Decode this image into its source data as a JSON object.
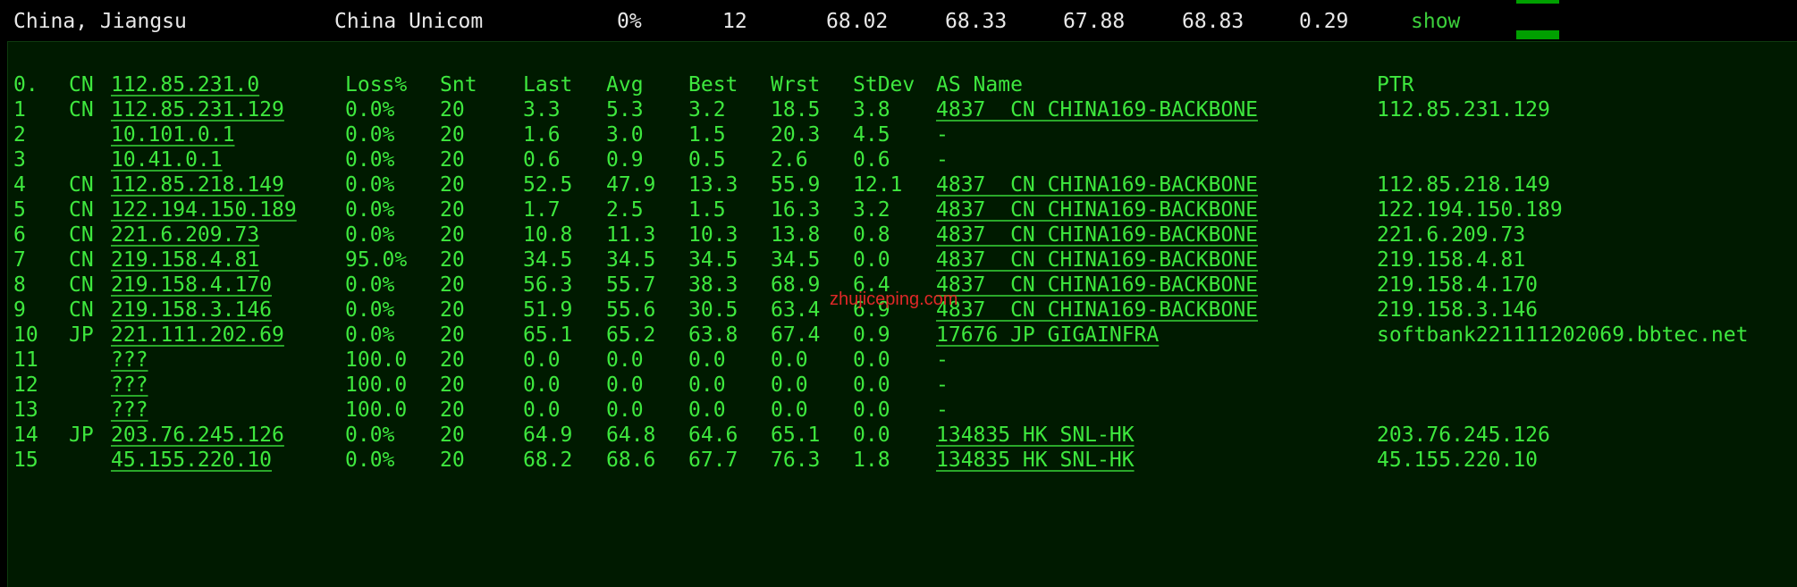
{
  "summary": {
    "location": "China, Jiangsu",
    "isp": "China Unicom",
    "loss": "0%",
    "sent": "12",
    "last": "68.02",
    "avg": "68.33",
    "best": "67.88",
    "worst": "68.83",
    "stdev": "0.29",
    "show_label": "show"
  },
  "colors": {
    "terminal_bg": "#001a00",
    "terminal_fg": "#3ee83e",
    "summary_fg": "#e8e8e8",
    "status_green": "#00a000",
    "watermark": "#e02828"
  },
  "watermark": "zhujiceping.com",
  "trace": {
    "headers": {
      "hop": "0.",
      "cc": "CN",
      "host": "112.85.231.0",
      "loss": "Loss%",
      "snt": "Snt",
      "last": "Last",
      "avg": "Avg",
      "best": "Best",
      "wrst": "Wrst",
      "stdev": "StDev",
      "as": "AS Name",
      "ptr": "PTR"
    },
    "rows": [
      {
        "hop": "1",
        "cc": "CN",
        "host": "112.85.231.129",
        "loss": "0.0%",
        "snt": "20",
        "last": "3.3",
        "avg": "5.3",
        "best": "3.2",
        "wrst": "18.5",
        "stdev": "3.8",
        "as": "4837  CN CHINA169-BACKBONE",
        "ptr": "112.85.231.129"
      },
      {
        "hop": "2",
        "cc": "",
        "host": "10.101.0.1",
        "loss": "0.0%",
        "snt": "20",
        "last": "1.6",
        "avg": "3.0",
        "best": "1.5",
        "wrst": "20.3",
        "stdev": "4.5",
        "as": "-",
        "ptr": ""
      },
      {
        "hop": "3",
        "cc": "",
        "host": "10.41.0.1",
        "loss": "0.0%",
        "snt": "20",
        "last": "0.6",
        "avg": "0.9",
        "best": "0.5",
        "wrst": "2.6",
        "stdev": "0.6",
        "as": "-",
        "ptr": ""
      },
      {
        "hop": "4",
        "cc": "CN",
        "host": "112.85.218.149",
        "loss": "0.0%",
        "snt": "20",
        "last": "52.5",
        "avg": "47.9",
        "best": "13.3",
        "wrst": "55.9",
        "stdev": "12.1",
        "as": "4837  CN CHINA169-BACKBONE",
        "ptr": "112.85.218.149"
      },
      {
        "hop": "5",
        "cc": "CN",
        "host": "122.194.150.189",
        "loss": "0.0%",
        "snt": "20",
        "last": "1.7",
        "avg": "2.5",
        "best": "1.5",
        "wrst": "16.3",
        "stdev": "3.2",
        "as": "4837  CN CHINA169-BACKBONE",
        "ptr": "122.194.150.189"
      },
      {
        "hop": "6",
        "cc": "CN",
        "host": "221.6.209.73",
        "loss": "0.0%",
        "snt": "20",
        "last": "10.8",
        "avg": "11.3",
        "best": "10.3",
        "wrst": "13.8",
        "stdev": "0.8",
        "as": "4837  CN CHINA169-BACKBONE",
        "ptr": "221.6.209.73"
      },
      {
        "hop": "7",
        "cc": "CN",
        "host": "219.158.4.81",
        "loss": "95.0%",
        "snt": "20",
        "last": "34.5",
        "avg": "34.5",
        "best": "34.5",
        "wrst": "34.5",
        "stdev": "0.0",
        "as": "4837  CN CHINA169-BACKBONE",
        "ptr": "219.158.4.81"
      },
      {
        "hop": "8",
        "cc": "CN",
        "host": "219.158.4.170",
        "loss": "0.0%",
        "snt": "20",
        "last": "56.3",
        "avg": "55.7",
        "best": "38.3",
        "wrst": "68.9",
        "stdev": "6.4",
        "as": "4837  CN CHINA169-BACKBONE",
        "ptr": "219.158.4.170"
      },
      {
        "hop": "9",
        "cc": "CN",
        "host": "219.158.3.146",
        "loss": "0.0%",
        "snt": "20",
        "last": "51.9",
        "avg": "55.6",
        "best": "30.5",
        "wrst": "63.4",
        "stdev": "6.9",
        "as": "4837  CN CHINA169-BACKBONE",
        "ptr": "219.158.3.146"
      },
      {
        "hop": "10",
        "cc": "JP",
        "host": "221.111.202.69",
        "loss": "0.0%",
        "snt": "20",
        "last": "65.1",
        "avg": "65.2",
        "best": "63.8",
        "wrst": "67.4",
        "stdev": "0.9",
        "as": "17676 JP GIGAINFRA",
        "ptr": "softbank221111202069.bbtec.net"
      },
      {
        "hop": "11",
        "cc": "",
        "host": "???",
        "loss": "100.0",
        "snt": "20",
        "last": "0.0",
        "avg": "0.0",
        "best": "0.0",
        "wrst": "0.0",
        "stdev": "0.0",
        "as": "-",
        "ptr": ""
      },
      {
        "hop": "12",
        "cc": "",
        "host": "???",
        "loss": "100.0",
        "snt": "20",
        "last": "0.0",
        "avg": "0.0",
        "best": "0.0",
        "wrst": "0.0",
        "stdev": "0.0",
        "as": "-",
        "ptr": ""
      },
      {
        "hop": "13",
        "cc": "",
        "host": "???",
        "loss": "100.0",
        "snt": "20",
        "last": "0.0",
        "avg": "0.0",
        "best": "0.0",
        "wrst": "0.0",
        "stdev": "0.0",
        "as": "-",
        "ptr": ""
      },
      {
        "hop": "14",
        "cc": "JP",
        "host": "203.76.245.126",
        "loss": "0.0%",
        "snt": "20",
        "last": "64.9",
        "avg": "64.8",
        "best": "64.6",
        "wrst": "65.1",
        "stdev": "0.0",
        "as": "134835 HK SNL-HK",
        "ptr": "203.76.245.126"
      },
      {
        "hop": "15",
        "cc": "",
        "host": "45.155.220.10",
        "loss": "0.0%",
        "snt": "20",
        "last": "68.2",
        "avg": "68.6",
        "best": "67.7",
        "wrst": "76.3",
        "stdev": "1.8",
        "as": "134835 HK SNL-HK",
        "ptr": "45.155.220.10"
      }
    ]
  }
}
